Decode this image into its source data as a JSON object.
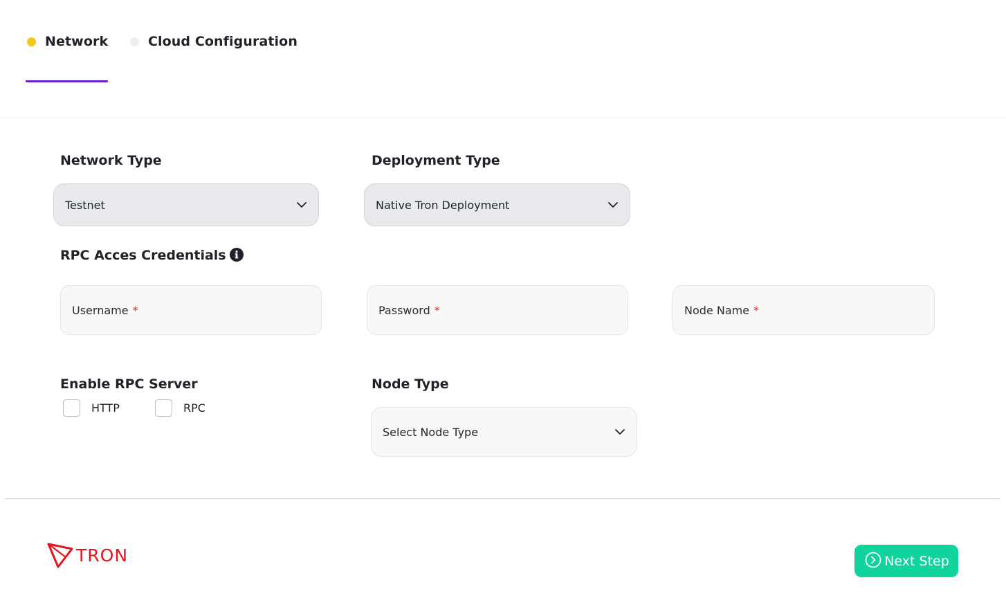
{
  "tabs": [
    {
      "label": "Network",
      "status_color": "#f5c518",
      "active": true
    },
    {
      "label": "Cloud Configuration",
      "status_color": "#ededef",
      "active": false
    }
  ],
  "accent_color": "#6a1fd1",
  "network_type": {
    "label": "Network Type",
    "value": "Testnet"
  },
  "deployment_type": {
    "label": "Deployment Type",
    "value": "Native Tron Deployment"
  },
  "rpc_credentials": {
    "label": "RPC Acces Credentials",
    "info_icon": "info-circle-icon",
    "fields": [
      {
        "placeholder": "Username",
        "required": "*"
      },
      {
        "placeholder": "Password",
        "required": "*"
      },
      {
        "placeholder": "Node Name",
        "required": "*"
      }
    ]
  },
  "enable_rpc": {
    "label": "Enable RPC Server",
    "options": [
      {
        "label": "HTTP",
        "checked": false
      },
      {
        "label": "RPC",
        "checked": false
      }
    ]
  },
  "node_type": {
    "label": "Node Type",
    "placeholder": "Select Node Type"
  },
  "logo": {
    "text": "TRON",
    "color": "#e3161f"
  },
  "next_button": {
    "label": "Next Step",
    "icon": "chevron-right-circle-icon",
    "color": "#10d49b"
  }
}
